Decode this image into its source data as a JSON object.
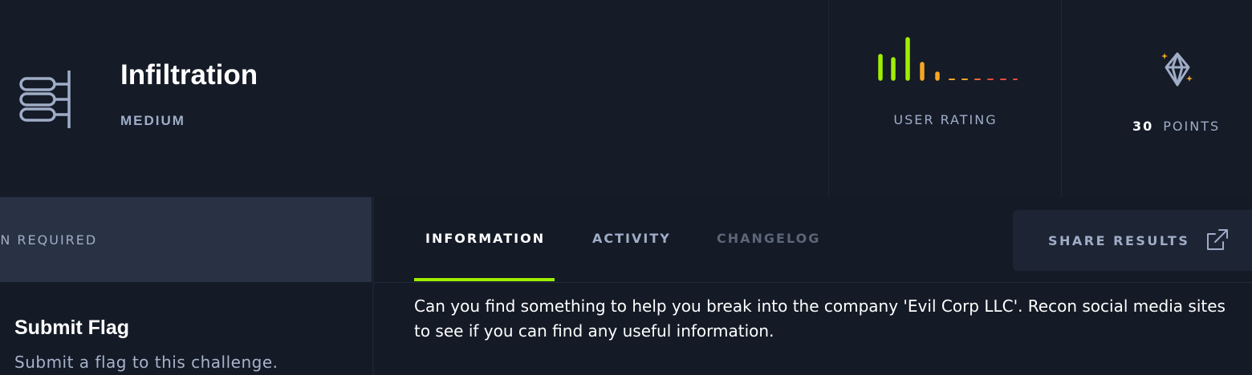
{
  "challenge": {
    "title": "Infiltration",
    "difficulty": "MEDIUM",
    "icon": "stacked-layers-icon"
  },
  "rating": {
    "label": "USER RATING",
    "colors": {
      "high": "#9fef00",
      "mid": "#f5a623",
      "low": "#e84b3c"
    }
  },
  "points": {
    "value": "30",
    "unit": "POINTS",
    "icon": "gem-icon"
  },
  "sidebar": {
    "connection_label": "ECTION REQUIRED",
    "submit_title": "Submit Flag",
    "submit_description": "Submit a flag to this challenge."
  },
  "tabs": [
    {
      "label": "INFORMATION",
      "active": true
    },
    {
      "label": "ACTIVITY",
      "active": false
    },
    {
      "label": "CHANGELOG",
      "active": false,
      "disabled": true
    }
  ],
  "share": {
    "label": "SHARE RESULTS",
    "icon": "share-icon"
  },
  "description": "Can you find something to help you break into the company 'Evil Corp LLC'. Recon social media sites to see if you can find any useful information.",
  "colors": {
    "accent": "#9fef00",
    "background": "#141a26",
    "panel": "#283244"
  }
}
